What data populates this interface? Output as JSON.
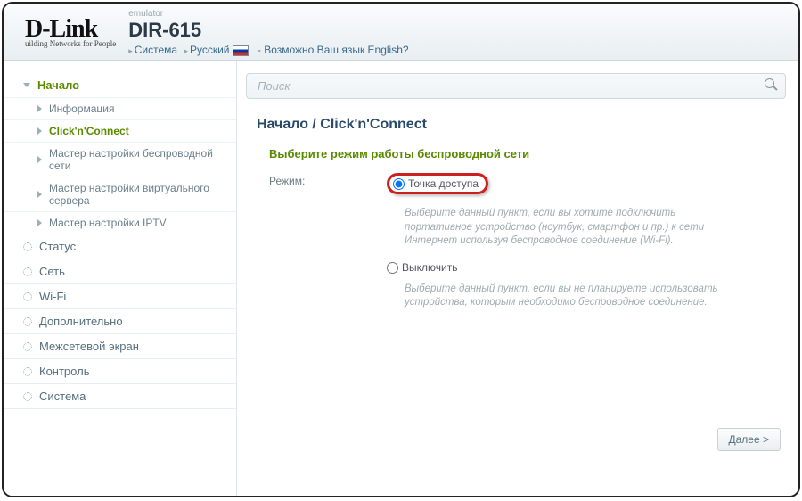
{
  "header": {
    "brand": "D-Link",
    "tagline": "uilding Networks for People",
    "emulator": "emulator",
    "model": "DIR-615",
    "system": "Система",
    "lang": "Русский",
    "lang_prompt": "- Возможно Ваш язык English?"
  },
  "search": {
    "placeholder": "Поиск"
  },
  "sidebar": {
    "top": [
      {
        "label": "Начало",
        "icon": "arrow-open",
        "current": true,
        "sub": [
          {
            "label": "Информация"
          },
          {
            "label": "Click'n'Connect",
            "active": true
          },
          {
            "label": "Мастер настройки беспроводной сети"
          },
          {
            "label": "Мастер настройки виртуального сервера"
          },
          {
            "label": "Мастер настройки IPTV"
          }
        ]
      },
      {
        "label": "Статус",
        "icon": "gear"
      },
      {
        "label": "Сеть",
        "icon": "gear"
      },
      {
        "label": "Wi-Fi",
        "icon": "gear"
      },
      {
        "label": "Дополнительно",
        "icon": "gear"
      },
      {
        "label": "Межсетевой экран",
        "icon": "gear"
      },
      {
        "label": "Контроль",
        "icon": "gear"
      },
      {
        "label": "Система",
        "icon": "gear"
      }
    ]
  },
  "main": {
    "breadcrumb": "Начало /  Click'n'Connect",
    "section_title": "Выберите режим работы беспроводной сети",
    "field_label": "Режим:",
    "options": [
      {
        "label": "Точка доступа",
        "checked": true,
        "highlight": true,
        "desc": "Выберите данный пункт, если вы хотите подключить портативное устройство (ноутбук, смартфон и пр.) к сети Интернет используя беспроводное соединение (Wi-Fi)."
      },
      {
        "label": "Выключить",
        "checked": false,
        "highlight": false,
        "desc": "Выберите данный пункт, если вы не планируете использовать устройства, которым необходимо беспроводное соединение."
      }
    ],
    "next": "Далее >"
  }
}
